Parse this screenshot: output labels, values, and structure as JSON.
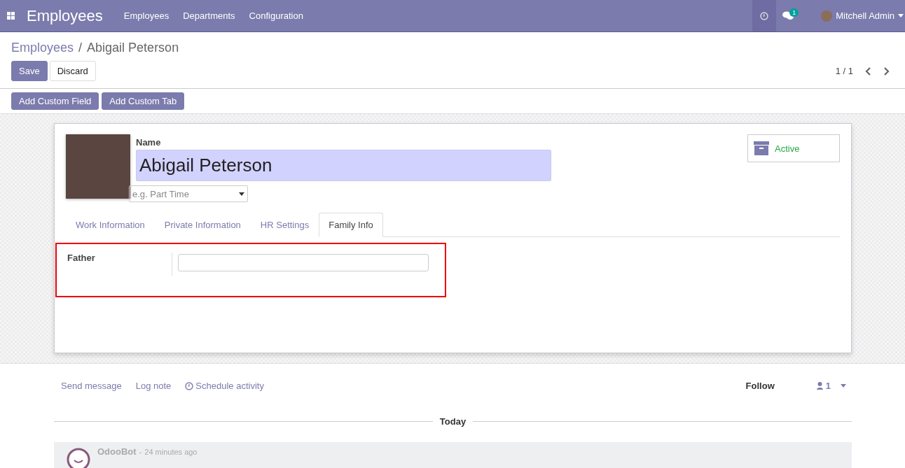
{
  "navbar": {
    "app_title": "Employees",
    "menu": [
      "Employees",
      "Departments",
      "Configuration"
    ],
    "messages_badge": "1",
    "user": "Mitchell Admin"
  },
  "breadcrumb": {
    "parent": "Employees",
    "separator": "/",
    "current": "Abigail Peterson"
  },
  "actions": [
    "Save",
    "Discard"
  ],
  "pager": {
    "text": "1 / 1"
  },
  "studio_buttons": [
    "Add Custom Field",
    "Add Custom Tab"
  ],
  "form": {
    "name_label": "Name",
    "name_value": "Abigail Peterson",
    "job_placeholder": "e.g. Part Time",
    "active_label": "Active",
    "tabs": [
      {
        "label": "Work Information",
        "selected": false
      },
      {
        "label": "Private Information",
        "selected": false
      },
      {
        "label": "HR Settings",
        "selected": false
      },
      {
        "label": "Family Info",
        "selected": true
      }
    ],
    "fields": [
      {
        "label": "Father"
      }
    ]
  },
  "chatter": {
    "actions": [
      "Send message",
      "Log note",
      "Schedule activity"
    ],
    "follow": "Follow",
    "followers": "1",
    "date_separator": "Today",
    "message": {
      "author": "OdooBot",
      "separator": "-",
      "time": "24 minutes ago"
    }
  }
}
